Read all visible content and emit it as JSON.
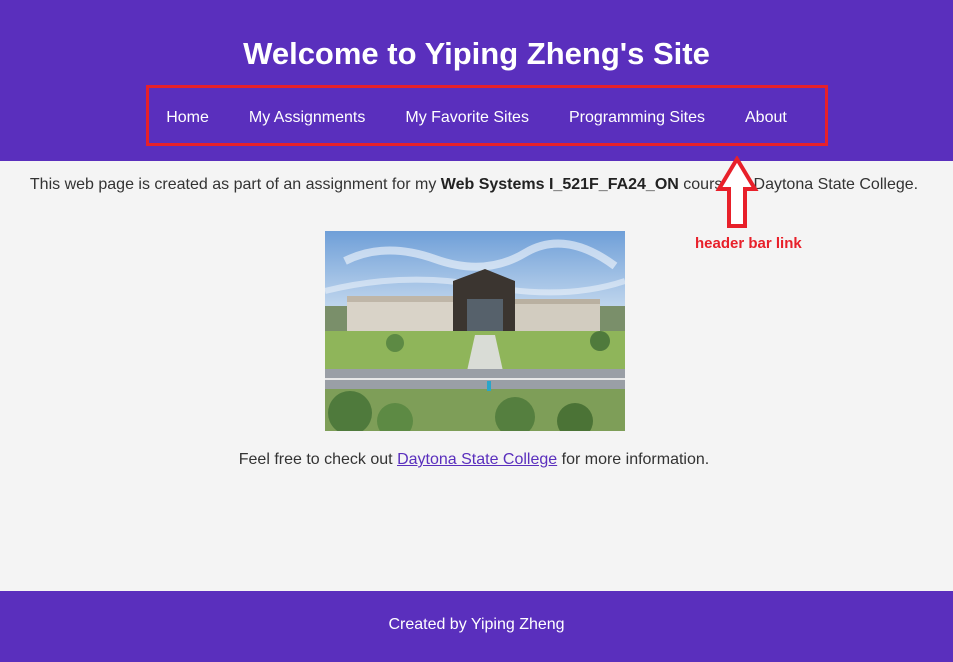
{
  "header": {
    "title": "Welcome to Yiping Zheng's Site",
    "nav": [
      "Home",
      "My Assignments",
      "My Favorite Sites",
      "Programming Sites",
      "About"
    ]
  },
  "intro": {
    "before": "This web page is created as part of an assignment for my ",
    "course": "Web Systems I_521F_FA24_ON",
    "after": " course at Daytona State College."
  },
  "annotation": {
    "label": "header bar link",
    "color": "#e8202a"
  },
  "more_info": {
    "before": "Feel free to check out ",
    "link": "Daytona State College",
    "after": " for more information."
  },
  "footer": {
    "text": "Created by Yiping Zheng"
  },
  "colors": {
    "brand": "#5a2fbd",
    "page_bg": "#f4f4f4",
    "annotation": "#e8202a"
  }
}
